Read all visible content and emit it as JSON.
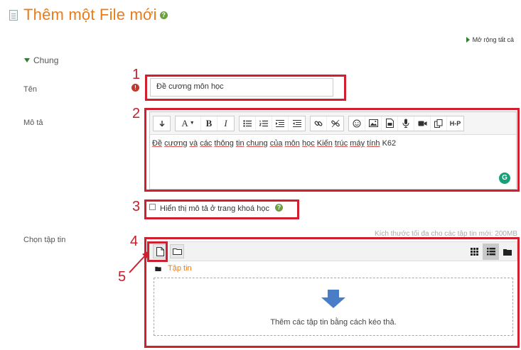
{
  "header": {
    "title": "Thêm một File mới"
  },
  "expand_all": "Mở rộng tất cả",
  "section": {
    "title": "Chung"
  },
  "fields": {
    "name": {
      "label": "Tên",
      "value": "Đề cương môn học"
    },
    "description": {
      "label": "Mô tả",
      "words": [
        "Đề",
        "cương",
        "và",
        "các",
        "thông",
        "tin",
        "chung",
        "của",
        "môn",
        "học",
        "Kiến",
        "trúc",
        "máy",
        "tính",
        "K62"
      ]
    },
    "show_description": {
      "label": "Hiển thị mô tả ở trang khoá học",
      "checked": false
    },
    "files": {
      "label": "Chọn tập tin",
      "max_size_note": "Kích thước tối đa cho các tập tin mới: 200MB"
    }
  },
  "toolbar": {
    "font_label": "A",
    "bold_label": "B",
    "italic_label": "I",
    "h5p_label": "H-P"
  },
  "filepicker": {
    "folder_label": "Tập tin",
    "drop_hint": "Thêm các tập tin bằng cách kéo thả."
  },
  "annotations": [
    "1",
    "2",
    "3",
    "4",
    "5"
  ],
  "colors": {
    "accent": "#e87c1b",
    "annotation": "#d02030",
    "arrow": "#4a7dc8"
  }
}
